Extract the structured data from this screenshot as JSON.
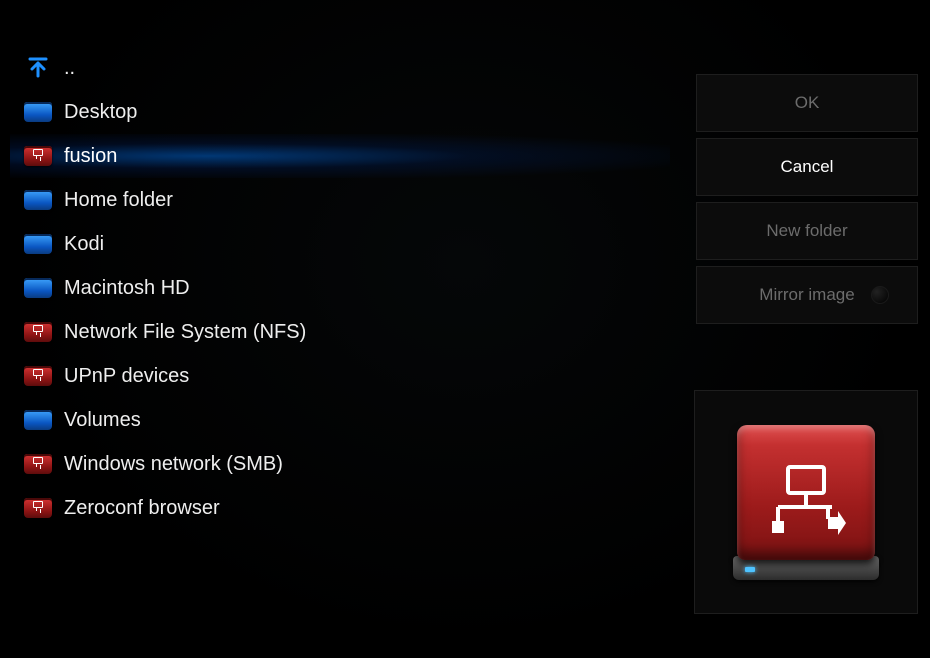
{
  "list": {
    "selected_index": 2,
    "items": [
      {
        "label": "..",
        "icon": "up",
        "selected": false
      },
      {
        "label": "Desktop",
        "icon": "blue",
        "selected": false
      },
      {
        "label": "fusion",
        "icon": "red",
        "selected": true
      },
      {
        "label": "Home folder",
        "icon": "blue",
        "selected": false
      },
      {
        "label": "Kodi",
        "icon": "blue",
        "selected": false
      },
      {
        "label": "Macintosh HD",
        "icon": "blue",
        "selected": false
      },
      {
        "label": "Network File System (NFS)",
        "icon": "red",
        "selected": false
      },
      {
        "label": "UPnP devices",
        "icon": "red",
        "selected": false
      },
      {
        "label": "Volumes",
        "icon": "blue",
        "selected": false
      },
      {
        "label": "Windows network (SMB)",
        "icon": "red",
        "selected": false
      },
      {
        "label": "Zeroconf browser",
        "icon": "red",
        "selected": false
      }
    ]
  },
  "buttons": {
    "ok": "OK",
    "cancel": "Cancel",
    "new_folder": "New folder",
    "mirror": "Mirror image"
  },
  "preview": {
    "kind": "network-drive"
  }
}
